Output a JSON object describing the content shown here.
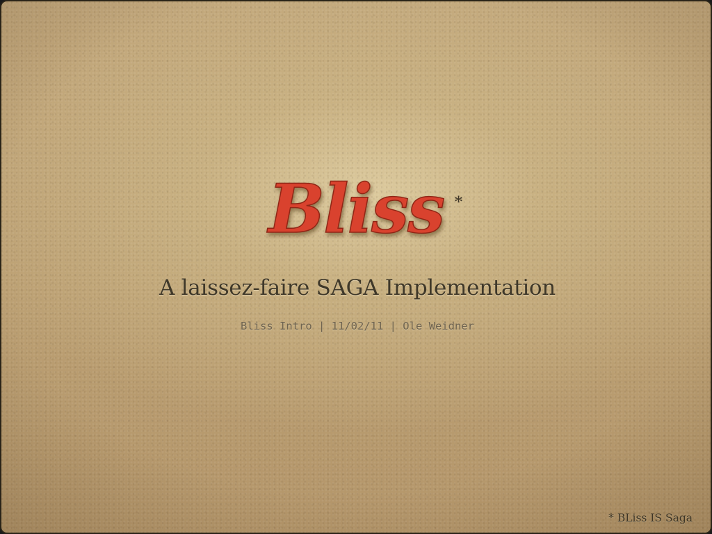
{
  "slide": {
    "logo_text": "Bliss",
    "logo_mark": "*",
    "title": "A laissez-faire SAGA Implementation",
    "subtitle": "Bliss Intro | 11/02/11 | Ole Weidner",
    "footnote": "* BLiss IS Saga"
  },
  "colors": {
    "background": "#bfa476",
    "logo_red": "#d9432e",
    "text_dark": "#3f3829",
    "text_muted": "#6f6450"
  }
}
